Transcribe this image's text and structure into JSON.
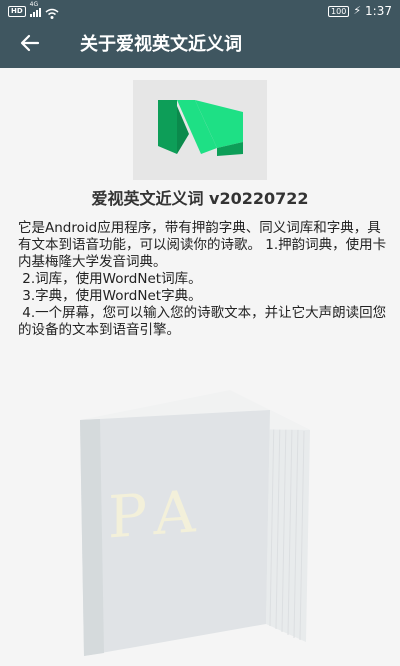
{
  "status_bar": {
    "badge_hd": "HD",
    "signal_text": "4G",
    "battery_text": "100",
    "time": "1:37",
    "icons": [
      "hd-icon",
      "signal-icon",
      "wifi-icon",
      "battery-icon",
      "charging-icon"
    ]
  },
  "app_bar": {
    "back_icon": "arrow-left-icon",
    "title": "关于爱视英文近义词"
  },
  "about": {
    "logo_icon": "medium-m-logo",
    "title": "爱视英文近义词 v20220722",
    "paragraphs": [
      "它是Android应用程序，带有押韵字典、同义词库和字典，具有文本到语音功能，可以阅读你的诗歌。 1.押韵词典，使用卡内基梅隆大学发音词典。",
      " 2.词库，使用WordNet词库。",
      " 3.字典，使用WordNet字典。",
      " 4.一个屏幕，您可以输入您的诗歌文本，并让它大声朗读回您的设备的文本到语音引擎。"
    ]
  },
  "watermark": {
    "icon": "book-icon",
    "text": "PA"
  },
  "colors": {
    "app_bar": "#3f5660",
    "logo_light": "#1ee085",
    "logo_dark": "#0d9e58",
    "background": "#f5f5f5"
  }
}
